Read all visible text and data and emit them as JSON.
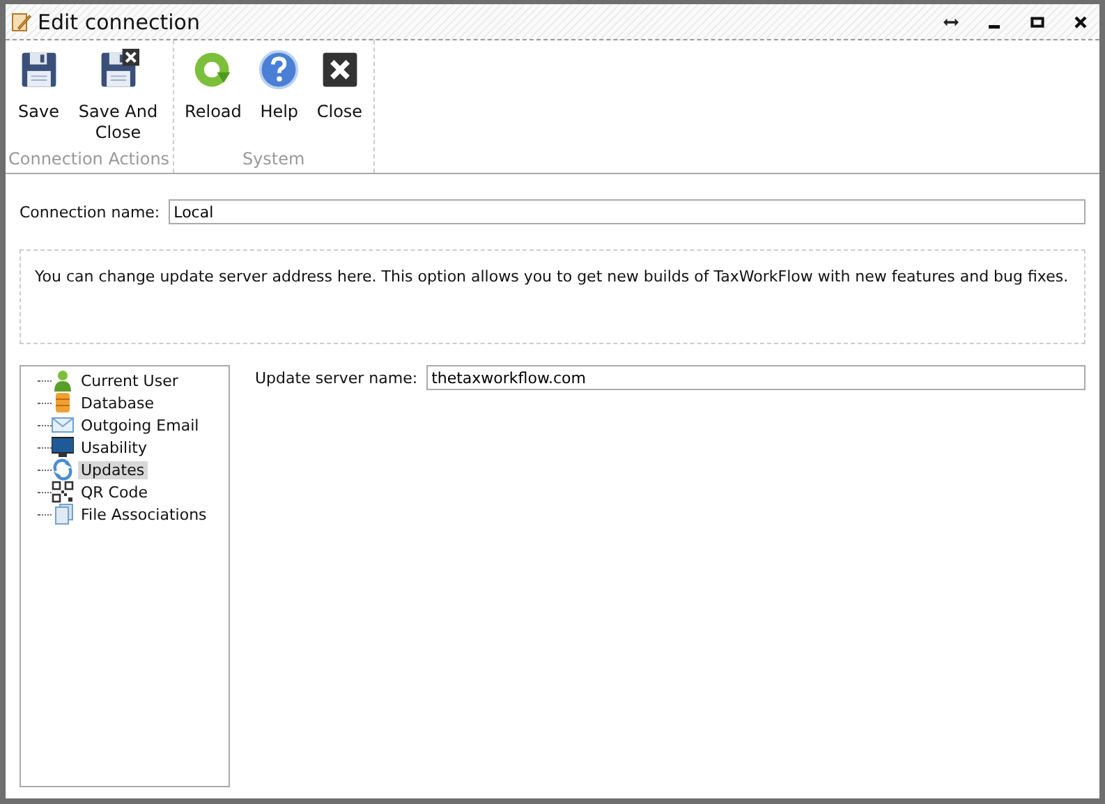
{
  "window": {
    "title": "Edit connection"
  },
  "ribbon": {
    "groups": [
      {
        "label": "Connection Actions",
        "buttons": [
          {
            "kind": "save",
            "label": "Save"
          },
          {
            "kind": "save-close",
            "label": "Save And Close"
          }
        ]
      },
      {
        "label": "System",
        "buttons": [
          {
            "kind": "reload",
            "label": "Reload"
          },
          {
            "kind": "help",
            "label": "Help"
          },
          {
            "kind": "close",
            "label": "Close"
          }
        ]
      }
    ]
  },
  "connection_name": {
    "label": "Connection name:",
    "value": "Local"
  },
  "info": "You can change update server address here. This option allows you to get new builds of TaxWorkFlow with new features and bug fixes.",
  "tree": [
    {
      "kind": "user",
      "label": "Current User",
      "selected": false
    },
    {
      "kind": "database",
      "label": "Database",
      "selected": false
    },
    {
      "kind": "email",
      "label": "Outgoing Email",
      "selected": false
    },
    {
      "kind": "monitor",
      "label": "Usability",
      "selected": false
    },
    {
      "kind": "updates",
      "label": "Updates",
      "selected": true
    },
    {
      "kind": "qr",
      "label": "QR Code",
      "selected": false
    },
    {
      "kind": "files",
      "label": "File Associations",
      "selected": false
    }
  ],
  "update_server": {
    "label": "Update server name:",
    "value": "thetaxworkflow.com"
  }
}
